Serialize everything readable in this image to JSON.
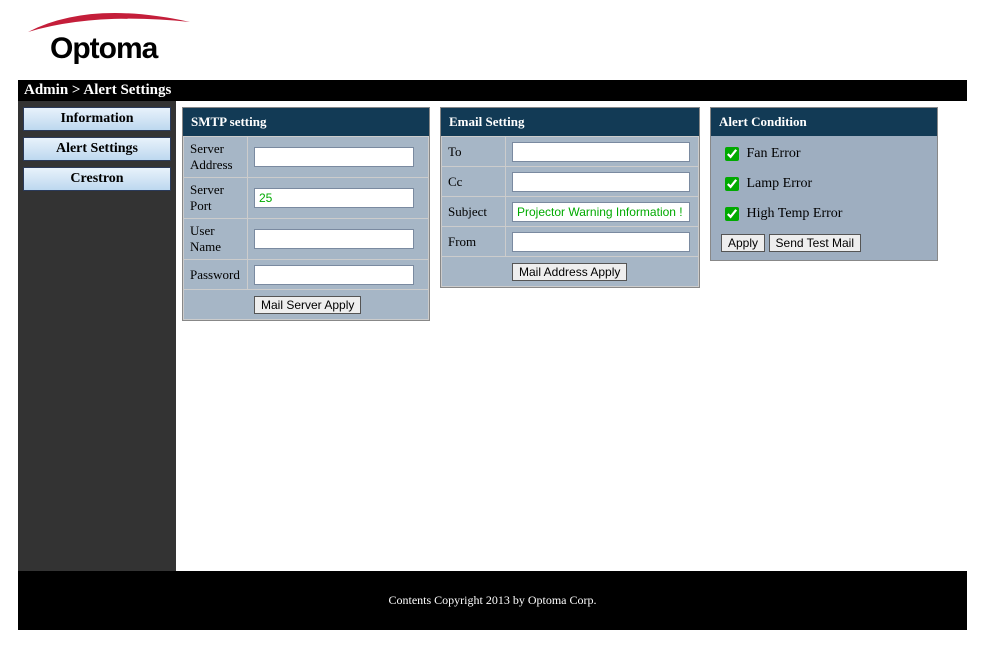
{
  "breadcrumb": "Admin > Alert Settings",
  "sidebar": {
    "items": [
      {
        "label": "Information"
      },
      {
        "label": "Alert Settings"
      },
      {
        "label": "Crestron"
      }
    ]
  },
  "smtp": {
    "title": "SMTP setting",
    "server_address_label": "Server Address",
    "server_address_value": "",
    "server_port_label": "Server Port",
    "server_port_value": "25",
    "user_name_label": "User Name",
    "user_name_value": "",
    "password_label": "Password",
    "password_value": "",
    "apply_label": "Mail Server Apply"
  },
  "email": {
    "title": "Email Setting",
    "to_label": "To",
    "to_value": "",
    "cc_label": "Cc",
    "cc_value": "",
    "subject_label": "Subject",
    "subject_value": "Projector Warning Information !",
    "from_label": "From",
    "from_value": "",
    "apply_label": "Mail Address Apply"
  },
  "alert": {
    "title": "Alert Condition",
    "fan_error_label": "Fan Error",
    "lamp_error_label": "Lamp Error",
    "high_temp_label": "High Temp Error",
    "apply_label": "Apply",
    "send_test_label": "Send Test Mail"
  },
  "footer": "Contents Copyright 2013 by Optoma Corp."
}
